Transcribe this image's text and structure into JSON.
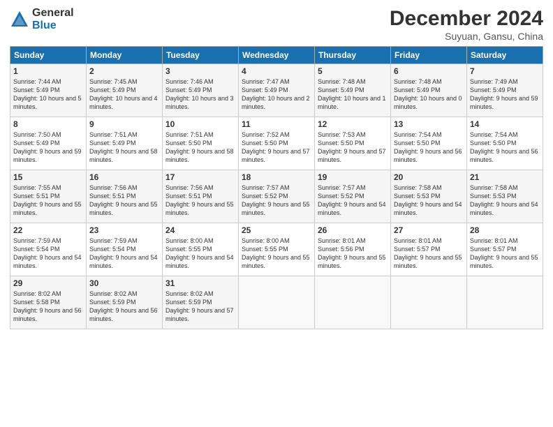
{
  "logo": {
    "general": "General",
    "blue": "Blue"
  },
  "title": "December 2024",
  "subtitle": "Suyuan, Gansu, China",
  "days_of_week": [
    "Sunday",
    "Monday",
    "Tuesday",
    "Wednesday",
    "Thursday",
    "Friday",
    "Saturday"
  ],
  "weeks": [
    [
      {
        "day": 1,
        "sunrise": "7:44 AM",
        "sunset": "5:49 PM",
        "daylight": "10 hours and 5 minutes."
      },
      {
        "day": 2,
        "sunrise": "7:45 AM",
        "sunset": "5:49 PM",
        "daylight": "10 hours and 4 minutes."
      },
      {
        "day": 3,
        "sunrise": "7:46 AM",
        "sunset": "5:49 PM",
        "daylight": "10 hours and 3 minutes."
      },
      {
        "day": 4,
        "sunrise": "7:47 AM",
        "sunset": "5:49 PM",
        "daylight": "10 hours and 2 minutes."
      },
      {
        "day": 5,
        "sunrise": "7:48 AM",
        "sunset": "5:49 PM",
        "daylight": "10 hours and 1 minute."
      },
      {
        "day": 6,
        "sunrise": "7:48 AM",
        "sunset": "5:49 PM",
        "daylight": "10 hours and 0 minutes."
      },
      {
        "day": 7,
        "sunrise": "7:49 AM",
        "sunset": "5:49 PM",
        "daylight": "9 hours and 59 minutes."
      }
    ],
    [
      {
        "day": 8,
        "sunrise": "7:50 AM",
        "sunset": "5:49 PM",
        "daylight": "9 hours and 59 minutes."
      },
      {
        "day": 9,
        "sunrise": "7:51 AM",
        "sunset": "5:49 PM",
        "daylight": "9 hours and 58 minutes."
      },
      {
        "day": 10,
        "sunrise": "7:51 AM",
        "sunset": "5:50 PM",
        "daylight": "9 hours and 58 minutes."
      },
      {
        "day": 11,
        "sunrise": "7:52 AM",
        "sunset": "5:50 PM",
        "daylight": "9 hours and 57 minutes."
      },
      {
        "day": 12,
        "sunrise": "7:53 AM",
        "sunset": "5:50 PM",
        "daylight": "9 hours and 57 minutes."
      },
      {
        "day": 13,
        "sunrise": "7:54 AM",
        "sunset": "5:50 PM",
        "daylight": "9 hours and 56 minutes."
      },
      {
        "day": 14,
        "sunrise": "7:54 AM",
        "sunset": "5:50 PM",
        "daylight": "9 hours and 56 minutes."
      }
    ],
    [
      {
        "day": 15,
        "sunrise": "7:55 AM",
        "sunset": "5:51 PM",
        "daylight": "9 hours and 55 minutes."
      },
      {
        "day": 16,
        "sunrise": "7:56 AM",
        "sunset": "5:51 PM",
        "daylight": "9 hours and 55 minutes."
      },
      {
        "day": 17,
        "sunrise": "7:56 AM",
        "sunset": "5:51 PM",
        "daylight": "9 hours and 55 minutes."
      },
      {
        "day": 18,
        "sunrise": "7:57 AM",
        "sunset": "5:52 PM",
        "daylight": "9 hours and 55 minutes."
      },
      {
        "day": 19,
        "sunrise": "7:57 AM",
        "sunset": "5:52 PM",
        "daylight": "9 hours and 54 minutes."
      },
      {
        "day": 20,
        "sunrise": "7:58 AM",
        "sunset": "5:53 PM",
        "daylight": "9 hours and 54 minutes."
      },
      {
        "day": 21,
        "sunrise": "7:58 AM",
        "sunset": "5:53 PM",
        "daylight": "9 hours and 54 minutes."
      }
    ],
    [
      {
        "day": 22,
        "sunrise": "7:59 AM",
        "sunset": "5:54 PM",
        "daylight": "9 hours and 54 minutes."
      },
      {
        "day": 23,
        "sunrise": "7:59 AM",
        "sunset": "5:54 PM",
        "daylight": "9 hours and 54 minutes."
      },
      {
        "day": 24,
        "sunrise": "8:00 AM",
        "sunset": "5:55 PM",
        "daylight": "9 hours and 54 minutes."
      },
      {
        "day": 25,
        "sunrise": "8:00 AM",
        "sunset": "5:55 PM",
        "daylight": "9 hours and 55 minutes."
      },
      {
        "day": 26,
        "sunrise": "8:01 AM",
        "sunset": "5:56 PM",
        "daylight": "9 hours and 55 minutes."
      },
      {
        "day": 27,
        "sunrise": "8:01 AM",
        "sunset": "5:57 PM",
        "daylight": "9 hours and 55 minutes."
      },
      {
        "day": 28,
        "sunrise": "8:01 AM",
        "sunset": "5:57 PM",
        "daylight": "9 hours and 55 minutes."
      }
    ],
    [
      {
        "day": 29,
        "sunrise": "8:02 AM",
        "sunset": "5:58 PM",
        "daylight": "9 hours and 56 minutes."
      },
      {
        "day": 30,
        "sunrise": "8:02 AM",
        "sunset": "5:59 PM",
        "daylight": "9 hours and 56 minutes."
      },
      {
        "day": 31,
        "sunrise": "8:02 AM",
        "sunset": "5:59 PM",
        "daylight": "9 hours and 57 minutes."
      },
      null,
      null,
      null,
      null
    ]
  ]
}
